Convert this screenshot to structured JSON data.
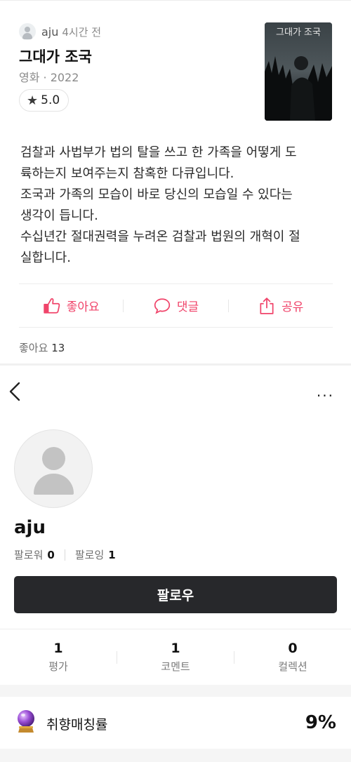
{
  "post": {
    "username": "aju",
    "time": "4시간 전",
    "movie_title": "그대가 조국",
    "movie_sub": "영화 · 2022",
    "rating": "5.0",
    "poster_text": "그대가 조국",
    "review_lines": [
      "검찰과 사법부가 법의 탈을 쓰고 한 가족을 어떻게 도",
      "륙하는지 보여주는지 참혹한 다큐입니다.",
      "조국과 가족의 모습이 바로 당신의 모습일 수 있다는",
      "생각이 듭니다.",
      "수십년간 절대권력을 누려온 검찰과 법원의 개혁이 절",
      "실합니다."
    ],
    "actions": {
      "like": "좋아요",
      "comment": "댓글",
      "share": "공유"
    },
    "likes_label": "좋아요",
    "likes_count": "13"
  },
  "profile": {
    "more_icon": "···",
    "name": "aju",
    "followers_label": "팔로워",
    "followers_count": "0",
    "following_label": "팔로잉",
    "following_count": "1",
    "follow_button": "팔로우",
    "stats": [
      {
        "value": "1",
        "label": "평가"
      },
      {
        "value": "1",
        "label": "코멘트"
      },
      {
        "value": "0",
        "label": "컬렉션"
      }
    ],
    "taste_label": "취향매칭률",
    "taste_value": "9%"
  },
  "colors": {
    "accent": "#f0446a",
    "button_bg": "#27282b"
  }
}
